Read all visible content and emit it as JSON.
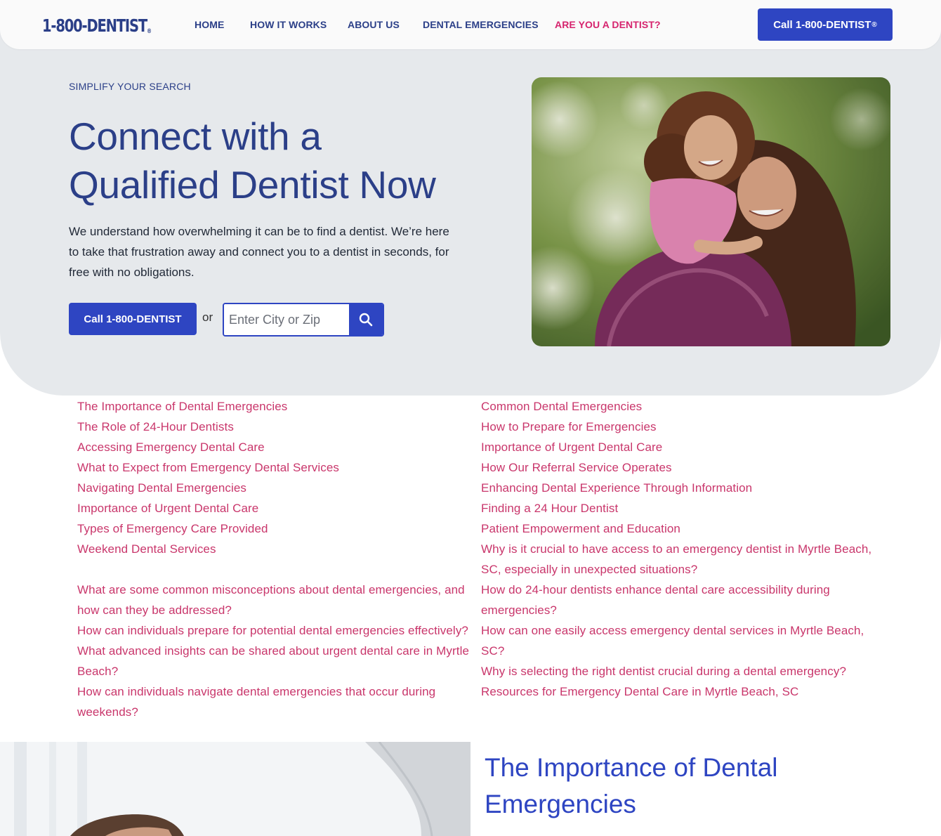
{
  "brand": {
    "logo_text": "1-800-DENTIST",
    "logo_mark": "®"
  },
  "nav": {
    "items": [
      {
        "label": "HOME"
      },
      {
        "label": "HOW IT WORKS"
      },
      {
        "label": "ABOUT US"
      },
      {
        "label": "DENTAL EMERGENCIES"
      },
      {
        "label": "ARE YOU A DENTIST?"
      }
    ],
    "cta_label": "Call 1-800-DENTIST",
    "cta_mark": "®"
  },
  "hero": {
    "eyebrow": "SIMPLIFY YOUR SEARCH",
    "title_line1": "Connect with a",
    "title_line2": "Qualified Dentist Now",
    "description": "We understand how overwhelming it can be to find a dentist. We’re here to take that frustration away and connect you to a dentist in seconds, for free with no obligations.",
    "cta_label": "Call 1-800-DENTIST",
    "or_text": "or",
    "search_placeholder": "Enter City or Zip",
    "search_icon": "search-icon"
  },
  "toc": {
    "left": [
      "The Importance of Dental Emergencies",
      "The Role of 24-Hour Dentists",
      "Accessing Emergency Dental Care",
      "What to Expect from Emergency Dental Services",
      "Navigating Dental Emergencies",
      "Importance of Urgent Dental Care",
      "Types of Emergency Care Provided",
      "Weekend Dental Services"
    ],
    "left_faq": [
      "What are some common misconceptions about dental emergencies, and how can they be addressed?",
      "How can individuals prepare for potential dental emergencies effectively?",
      "What advanced insights can be shared about urgent dental care in Myrtle Beach?",
      "How can individuals navigate dental emergencies that occur during weekends?"
    ],
    "right": [
      "Common Dental Emergencies",
      "How to Prepare for Emergencies",
      "Importance of Urgent Dental Care",
      "How Our Referral Service Operates",
      "Enhancing Dental Experience Through Information",
      "Finding a 24 Hour Dentist",
      "Patient Empowerment and Education",
      "Why is it crucial to have access to an emergency dentist in Myrtle Beach, SC, especially in unexpected situations?",
      "How do 24-hour dentists enhance dental care accessibility during emergencies?",
      "How can one easily access emergency dental services in Myrtle Beach, SC?",
      "Why is selecting the right dentist crucial during a dental emergency?",
      "Resources for Emergency Dental Care in Myrtle Beach, SC"
    ]
  },
  "section": {
    "title": "The Importance of Dental Emergencies"
  },
  "colors": {
    "brand_blue": "#2b3f88",
    "button_blue": "#2e45c2",
    "accent_pink": "#d6246e",
    "link_pink": "#c9366b",
    "hero_bg": "#e6e9ec"
  }
}
